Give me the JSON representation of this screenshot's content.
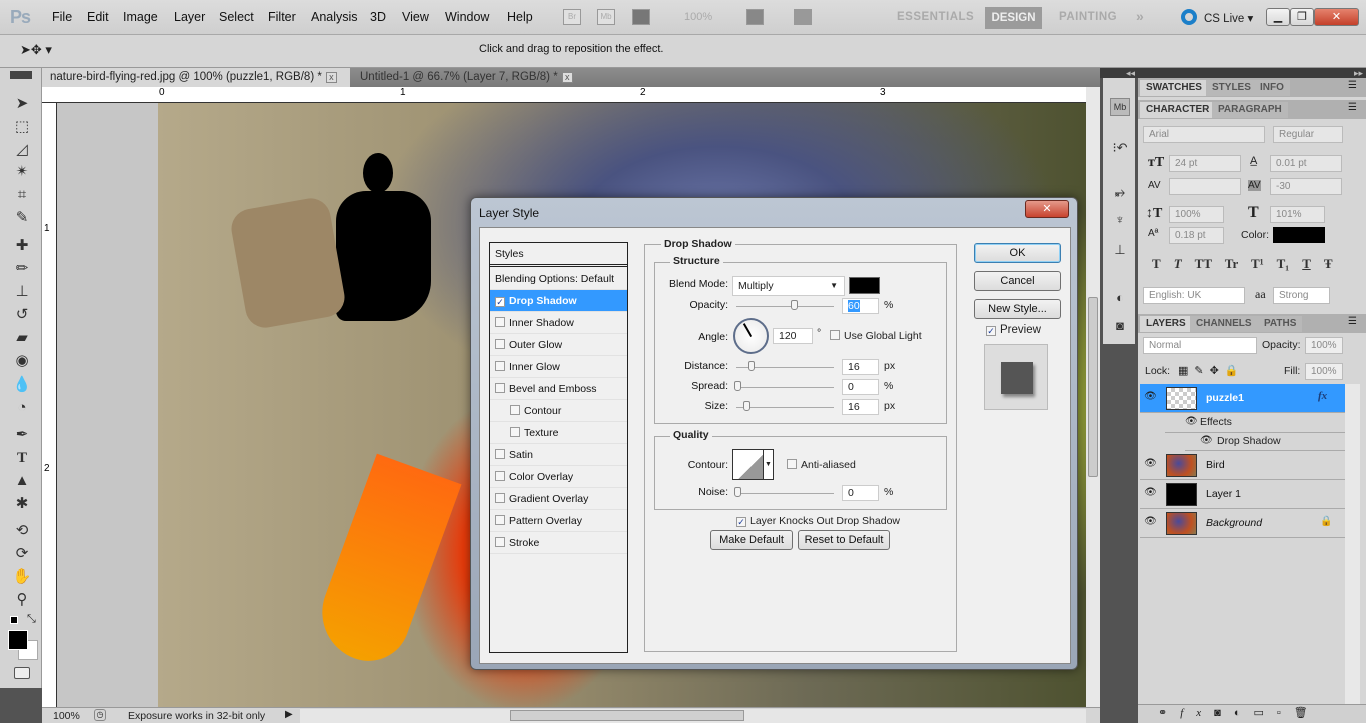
{
  "app": {
    "logo": "Ps",
    "menu": [
      "File",
      "Edit",
      "Image",
      "Layer",
      "Select",
      "Filter",
      "Analysis",
      "3D",
      "View",
      "Window",
      "Help"
    ],
    "zoom_level": "100%",
    "workspaces": [
      "ESSENTIALS",
      "DESIGN",
      "PAINTING"
    ],
    "active_workspace": "DESIGN",
    "more_workspaces": "»",
    "cs_live": "CS Live ▾"
  },
  "options_bar": {
    "tool_icon": "move-tool",
    "hint": "Click and drag to reposition the effect."
  },
  "documents": {
    "tabs": [
      {
        "label": "nature-bird-flying-red.jpg @ 100% (puzzle1, RGB/8) *",
        "active": true
      },
      {
        "label": "Untitled-1 @ 66.7% (Layer 7, RGB/8) *",
        "active": false
      }
    ]
  },
  "rulers": {
    "horizontal": [
      "0",
      "1",
      "2",
      "3"
    ],
    "vertical": [
      "1",
      "2"
    ]
  },
  "status": {
    "zoom": "100%",
    "message": "Exposure works in 32-bit only"
  },
  "dialog": {
    "title": "Layer Style",
    "styles_header": "Styles",
    "blending": "Blending Options: Default",
    "styles": [
      {
        "label": "Drop Shadow",
        "checked": true,
        "selected": true,
        "indent": false
      },
      {
        "label": "Inner Shadow",
        "checked": false,
        "indent": false
      },
      {
        "label": "Outer Glow",
        "checked": false,
        "indent": false
      },
      {
        "label": "Inner Glow",
        "checked": false,
        "indent": false
      },
      {
        "label": "Bevel and Emboss",
        "checked": false,
        "indent": false
      },
      {
        "label": "Contour",
        "checked": false,
        "indent": true
      },
      {
        "label": "Texture",
        "checked": false,
        "indent": true
      },
      {
        "label": "Satin",
        "checked": false,
        "indent": false
      },
      {
        "label": "Color Overlay",
        "checked": false,
        "indent": false
      },
      {
        "label": "Gradient Overlay",
        "checked": false,
        "indent": false
      },
      {
        "label": "Pattern Overlay",
        "checked": false,
        "indent": false
      },
      {
        "label": "Stroke",
        "checked": false,
        "indent": false
      }
    ],
    "section_title": "Drop Shadow",
    "structure_title": "Structure",
    "blend_mode_label": "Blend Mode:",
    "blend_mode": "Multiply",
    "shadow_color": "#000000",
    "opacity_label": "Opacity:",
    "opacity": "60",
    "opacity_pct": 60,
    "angle_label": "Angle:",
    "angle": "120",
    "angle_unit": "°",
    "use_global_light": "Use Global Light",
    "use_global_light_checked": false,
    "distance_label": "Distance:",
    "distance": "16",
    "distance_unit": "px",
    "spread_label": "Spread:",
    "spread": "0",
    "spread_unit": "%",
    "size_label": "Size:",
    "size": "16",
    "size_unit": "px",
    "percent_unit": "%",
    "quality_title": "Quality",
    "contour_label": "Contour:",
    "anti_aliased": "Anti-aliased",
    "noise_label": "Noise:",
    "noise": "0",
    "knockout": "Layer Knocks Out Drop Shadow",
    "knockout_checked": true,
    "make_default": "Make Default",
    "reset_default": "Reset to Default",
    "ok": "OK",
    "cancel": "Cancel",
    "new_style": "New Style...",
    "preview": "Preview",
    "preview_checked": true
  },
  "panels": {
    "top_tabs": [
      "SWATCHES",
      "STYLES",
      "INFO"
    ],
    "char_tabs": [
      "CHARACTER",
      "PARAGRAPH"
    ],
    "character": {
      "font": "Arial",
      "style": "Regular",
      "size": "24 pt",
      "leading": "0.01 pt",
      "kerning": "",
      "tracking": "-30",
      "vscale": "100%",
      "hscale": "101%",
      "baseline": "0.18 pt",
      "color_label": "Color:",
      "color": "#000000",
      "language": "English: UK",
      "aa_label": "aa",
      "antialias": "Strong",
      "type_buttons": [
        "T",
        "T",
        "TT",
        "Tr",
        "T¹",
        "T₁",
        "T",
        "Ŧ"
      ]
    },
    "layer_tabs": [
      "LAYERS",
      "CHANNELS",
      "PATHS"
    ],
    "layers": {
      "blend": "Normal",
      "opacity_label": "Opacity:",
      "opacity": "100%",
      "lock_label": "Lock:",
      "fill_label": "Fill:",
      "fill": "100%",
      "items": [
        {
          "name": "puzzle1",
          "selected": true,
          "fx": "fx"
        },
        {
          "name": "Effects",
          "sub": 1
        },
        {
          "name": "Drop Shadow",
          "sub": 2
        },
        {
          "name": "Bird"
        },
        {
          "name": "Layer 1"
        },
        {
          "name": "Background",
          "italic": true,
          "locked": true
        }
      ]
    }
  }
}
